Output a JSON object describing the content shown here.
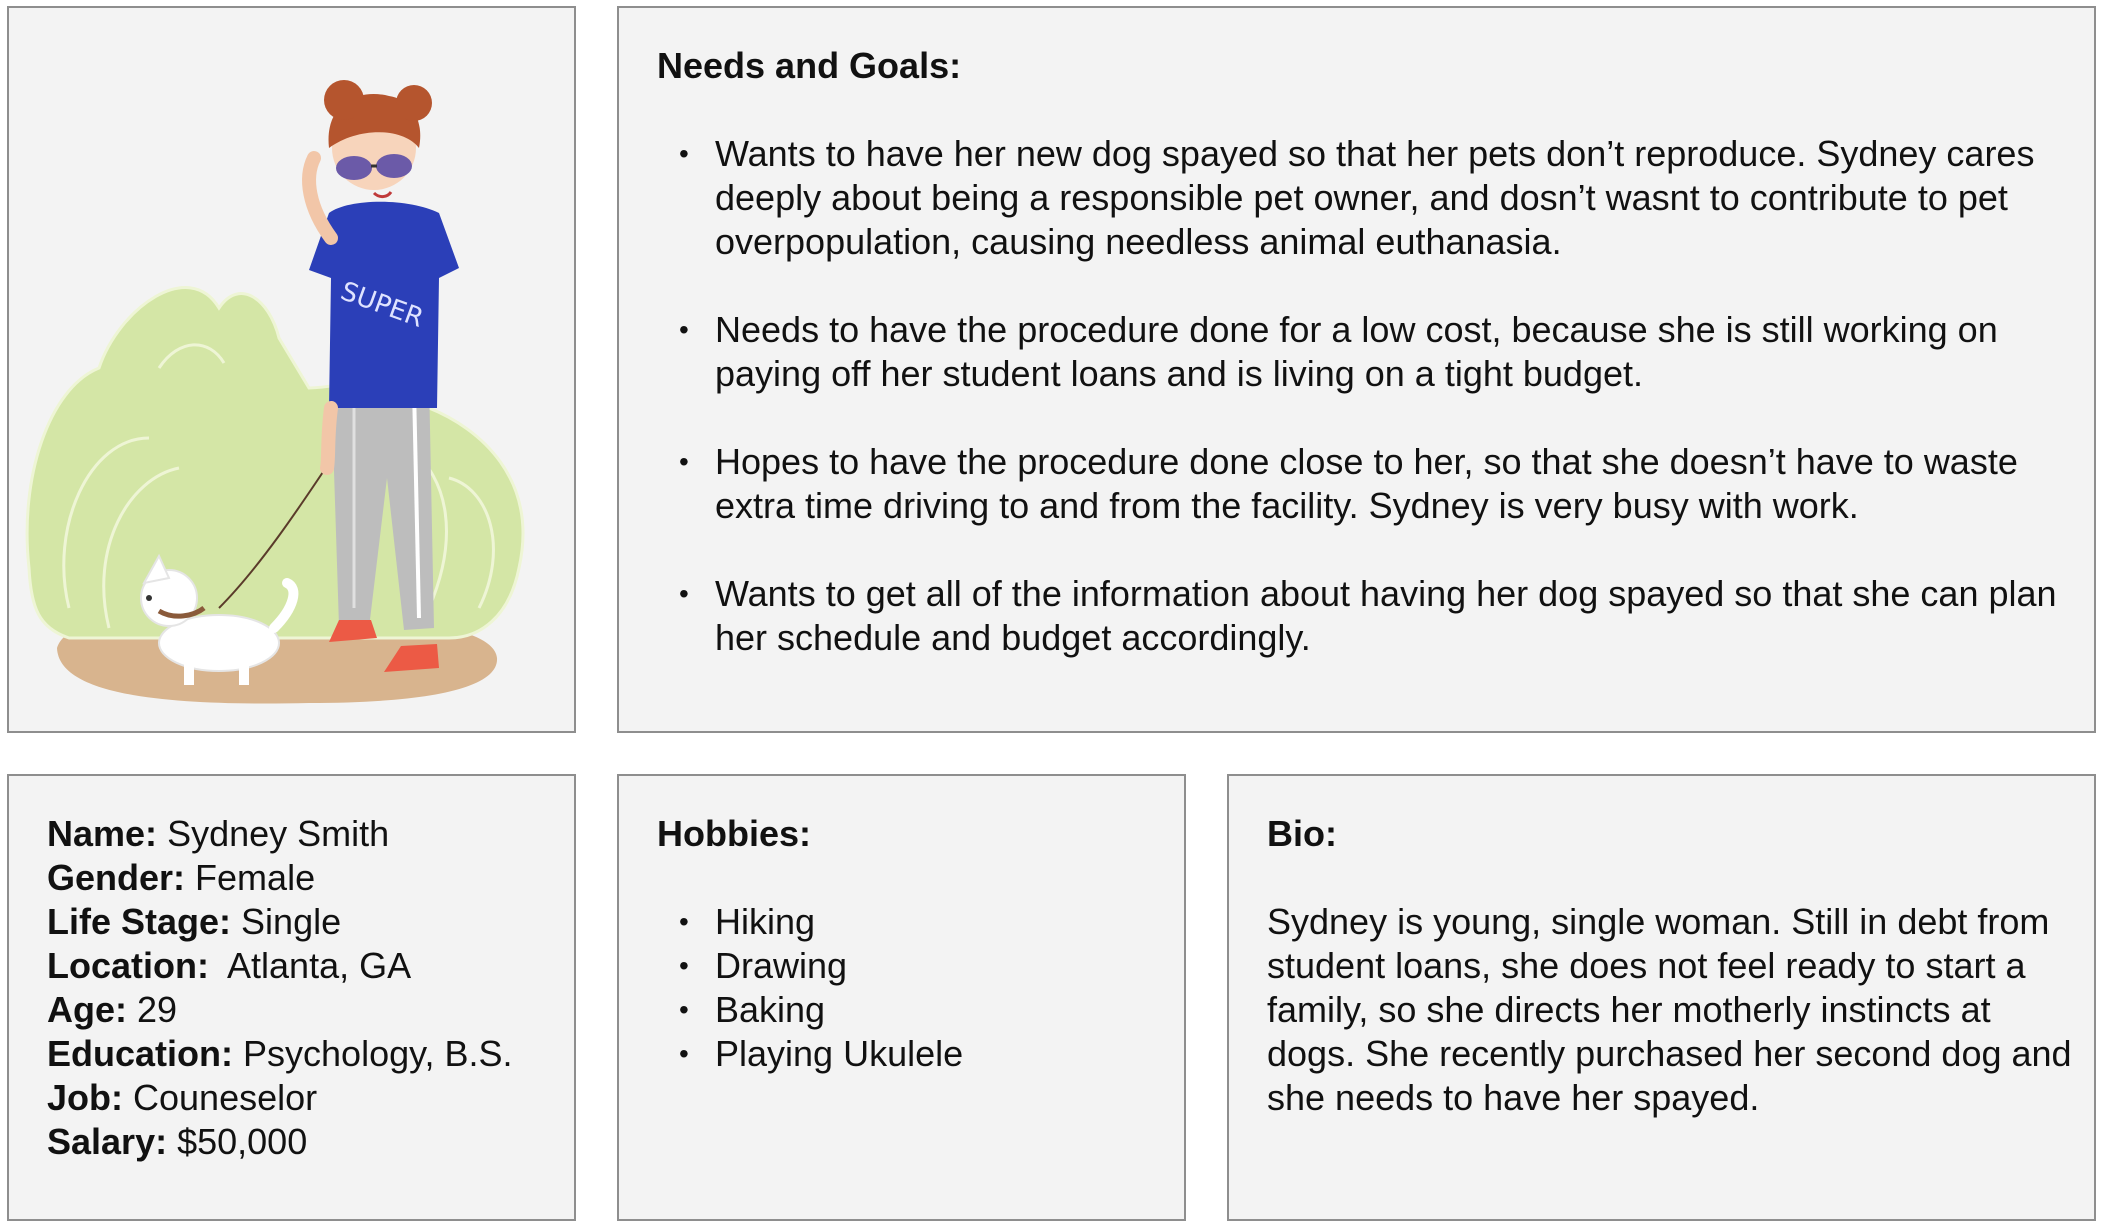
{
  "needs": {
    "title": "Needs and Goals:",
    "items": [
      "Wants to have her new dog spayed so that her pets don’t reproduce. Sydney cares deeply about being a responsible pet owner, and dosn’t wasnt to contribute to pet overpopulation, causing needless animal euthanasia.",
      "Needs to have the procedure done for a low cost, because she is still working on paying off her student loans and is living on a tight budget.",
      "Hopes to have the procedure done close to her, so that she doesn’t have to waste extra time driving to and from the facility. Sydney is very busy with work.",
      "Wants to get all of the information about having her dog spayed so that she can plan her schedule and budget accordingly."
    ]
  },
  "demographics": {
    "name": {
      "label": "Name:",
      "value": "Sydney Smith"
    },
    "gender": {
      "label": "Gender:",
      "value": "Female"
    },
    "life_stage": {
      "label": "Life Stage:",
      "value": "Single"
    },
    "location": {
      "label": "Location:",
      "value": "Atlanta, GA"
    },
    "age": {
      "label": "Age:",
      "value": "29"
    },
    "education": {
      "label": "Education:",
      "value": "Psychology, B.S."
    },
    "job": {
      "label": "Job:",
      "value": "Couneselor"
    },
    "salary": {
      "label": "Salary:",
      "value": "$50,000"
    }
  },
  "hobbies": {
    "title": "Hobbies:",
    "items": [
      "Hiking",
      "Drawing",
      "Baking",
      "Playing Ukulele"
    ]
  },
  "bio": {
    "title": "Bio:",
    "text": "Sydney is young, single woman. Still in debt from student loans, she does not feel ready to start a family, so she directs her motherly instincts at dogs. She recently purchased her second dog and she needs to have her spayed."
  },
  "illustration": {
    "shirt_text": "SUPER",
    "colors": {
      "bush": "#d4e6a6",
      "ground": "#d8b48e",
      "shirt": "#2b3fb8",
      "pants": "#bdbdbd",
      "hair": "#b5552e",
      "shoes": "#ec5a45",
      "dog": "#ffffff"
    }
  }
}
